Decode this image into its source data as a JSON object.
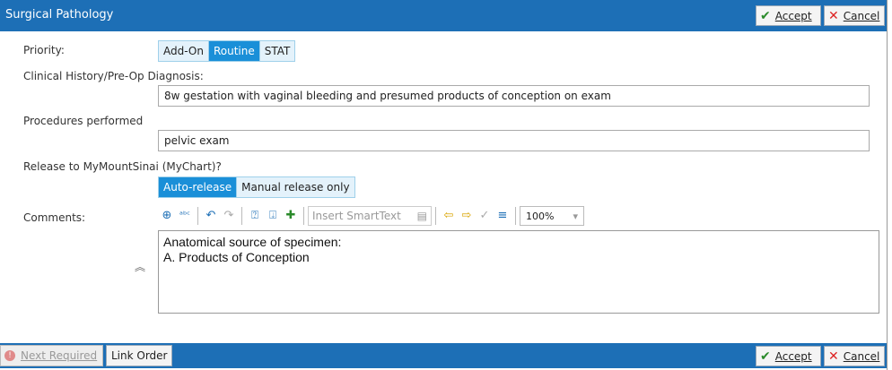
{
  "window": {
    "title": "Surgical Pathology"
  },
  "actions": {
    "accept": "Accept",
    "cancel": "Cancel"
  },
  "priority": {
    "label": "Priority:",
    "options": [
      "Add-On",
      "Routine",
      "STAT"
    ],
    "selected": "Routine"
  },
  "clinical_history": {
    "label": "Clinical History/Pre-Op Diagnosis:",
    "value": "8w gestation with vaginal bleeding and presumed products of conception on exam"
  },
  "procedures": {
    "label": "Procedures performed",
    "value": "pelvic exam"
  },
  "release": {
    "label": "Release to MyMountSinai (MyChart)?",
    "options": [
      "Auto-release",
      "Manual release only"
    ],
    "selected": "Auto-release"
  },
  "comments": {
    "label": "Comments:",
    "toolbar": {
      "smarttext_placeholder": "Insert SmartText",
      "zoom": "100%"
    },
    "lines": [
      "Anatomical source of specimen:",
      "A. Products of Conception"
    ]
  },
  "footer": {
    "next_required": "Next Required",
    "link_order": "Link Order"
  },
  "colors": {
    "header": "#1d6fb6",
    "selected": "#1a8fd8",
    "option_bg": "#e4f2fb"
  }
}
